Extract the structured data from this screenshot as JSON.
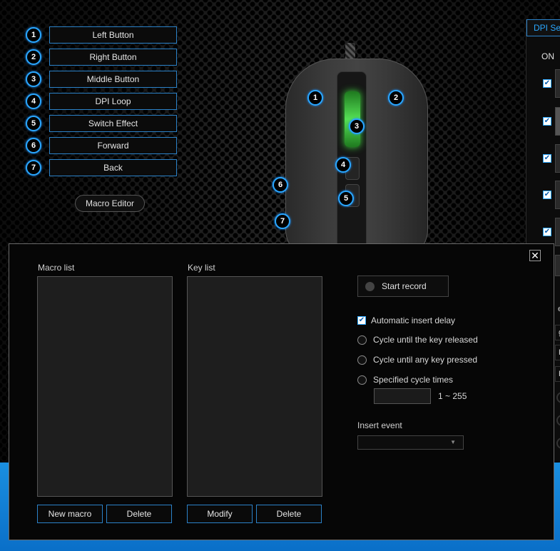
{
  "button_assignments": [
    {
      "num": "1",
      "label": "Left Button"
    },
    {
      "num": "2",
      "label": "Right Button"
    },
    {
      "num": "3",
      "label": "Middle Button"
    },
    {
      "num": "4",
      "label": "DPI Loop"
    },
    {
      "num": "5",
      "label": "Switch Effect"
    },
    {
      "num": "6",
      "label": "Forward"
    },
    {
      "num": "7",
      "label": "Back"
    }
  ],
  "macro_editor_label": "Macro Editor",
  "mouse_markers": [
    "1",
    "2",
    "3",
    "4",
    "5",
    "6",
    "7"
  ],
  "dpi_panel": {
    "title": "DPI Settings",
    "on_label": "ON",
    "check_mark": "✔",
    "frag_e": "e",
    "frag_g": "g",
    "frag_f1": "F",
    "frag_f2": "F"
  },
  "macro_dialog": {
    "close_label": "✕",
    "macro_list_label": "Macro list",
    "key_list_label": "Key list",
    "new_macro_label": "New macro",
    "delete_macro_label": "Delete",
    "modify_label": "Modify",
    "delete_key_label": "Delete",
    "start_record_label": "Start record",
    "auto_insert_delay_label": "Automatic insert delay",
    "auto_insert_delay_checked": true,
    "check_mark": "✔",
    "cycle_released_label": "Cycle until the key released",
    "cycle_any_key_label": "Cycle until any key pressed",
    "specified_cycle_label": "Specified cycle times",
    "cycle_times_value": "",
    "cycle_range_label": "1 ~ 255",
    "insert_event_label": "Insert event",
    "insert_event_value": "",
    "select_arrow": "▼"
  },
  "colors": {
    "accent": "#2aa7ff",
    "wheel_glow": "#3fd63f",
    "floor_blue": "#1a8fe0"
  }
}
